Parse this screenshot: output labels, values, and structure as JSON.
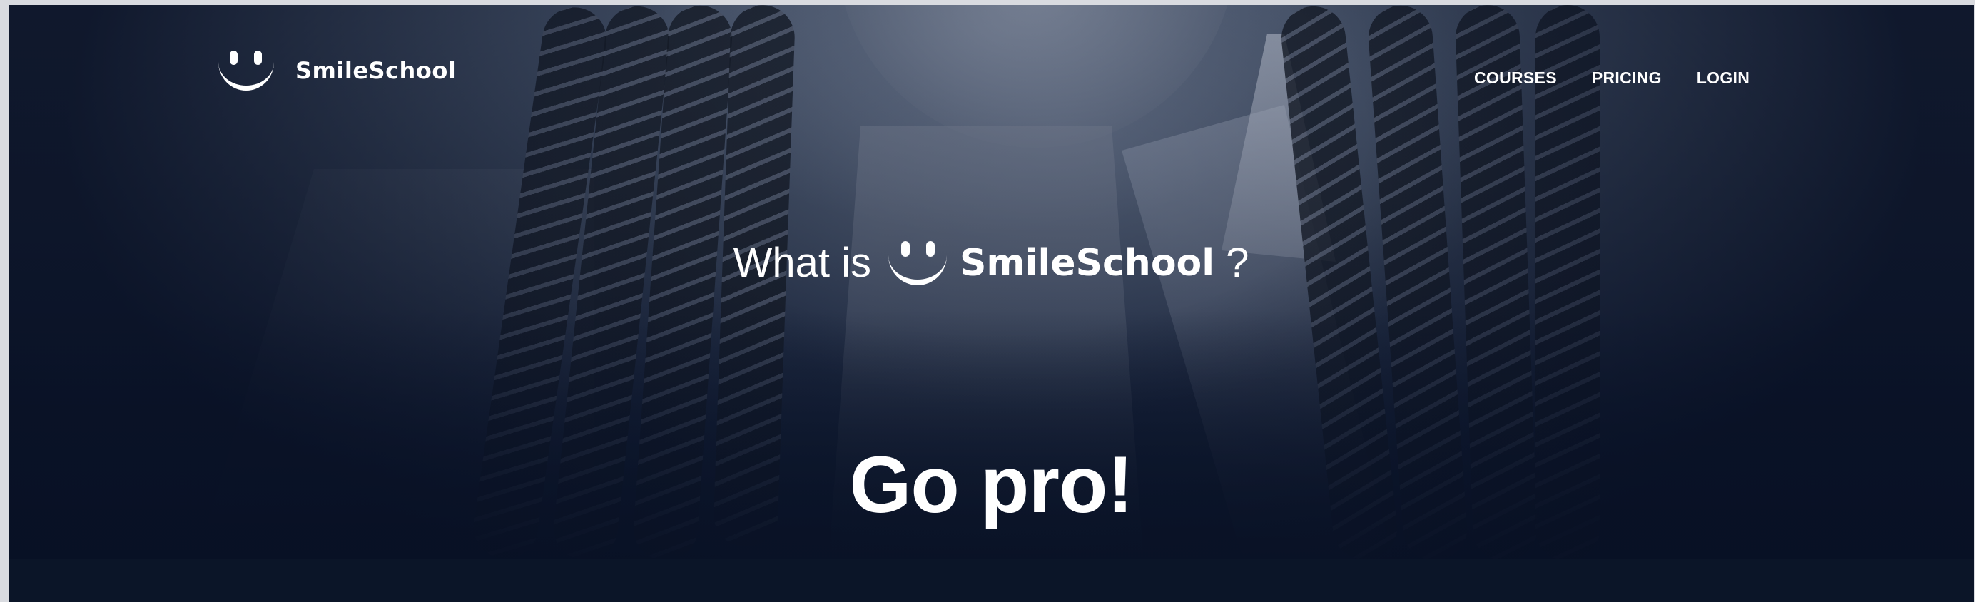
{
  "brand": {
    "name": "SmileSchool",
    "logo_icon": "smile-icon"
  },
  "nav": {
    "items": [
      {
        "label": "COURSES"
      },
      {
        "label": "PRICING"
      },
      {
        "label": "LOGIN"
      }
    ]
  },
  "hero": {
    "headline_prefix": "What is",
    "headline_brand": "SmileSchool",
    "headline_suffix": "?",
    "tagline": "Go pro!"
  },
  "colors": {
    "background": "#0b1528",
    "text": "#ffffff"
  }
}
